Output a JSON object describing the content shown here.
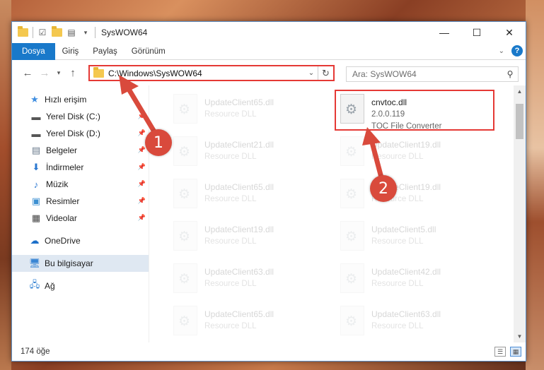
{
  "window": {
    "title": "SysWOW64",
    "controls": {
      "minimize": "—",
      "maximize": "☐",
      "close": "✕"
    }
  },
  "ribbon": {
    "tabs": [
      "Dosya",
      "Giriş",
      "Paylaş",
      "Görünüm"
    ],
    "active_tab": 0
  },
  "address_bar": {
    "path": "C:\\Windows\\SysWOW64",
    "search_placeholder": "Ara: SysWOW64"
  },
  "sidebar": {
    "quick_access": "Hızlı erişim",
    "items": [
      "Yerel Disk (C:)",
      "Yerel Disk (D:)",
      "Belgeler",
      "İndirmeler",
      "Müzik",
      "Resimler",
      "Videolar"
    ],
    "onedrive": "OneDrive",
    "this_pc": "Bu bilgisayar",
    "network": "Ağ"
  },
  "files_left": [
    {
      "name": "UpdateClient65.dll",
      "type": "Resource DLL"
    },
    {
      "name": "UpdateClient21.dll",
      "type": "Resource DLL"
    },
    {
      "name": "UpdateClient65.dll",
      "type": "Resource DLL"
    },
    {
      "name": "UpdateClient19.dll",
      "type": "Resource DLL"
    },
    {
      "name": "UpdateClient63.dll",
      "type": "Resource DLL"
    },
    {
      "name": "UpdateClient65.dll",
      "type": "Resource DLL"
    }
  ],
  "files_right": [
    {
      "name": "cnvtoc.dll",
      "version": "2.0.0.119",
      "type": "TOC File Converter"
    },
    {
      "name": "UpdateClient19.dll",
      "type": "Resource DLL"
    },
    {
      "name": "UpdateClient19.dll",
      "type": "Resource DLL"
    },
    {
      "name": "UpdateClient5.dll",
      "type": "Resource DLL"
    },
    {
      "name": "UpdateClient42.dll",
      "type": "Resource DLL"
    },
    {
      "name": "UpdateClient63.dll",
      "type": "Resource DLL"
    }
  ],
  "status": {
    "count": "174 öğe"
  },
  "callouts": [
    "1",
    "2"
  ],
  "colors": {
    "accent": "#1979ca",
    "highlight": "#e53935",
    "callout": "#d94a3c"
  },
  "icons": {
    "back": "arrow-left-icon",
    "forward": "arrow-right-icon",
    "recent": "chevron-down-icon",
    "up": "arrow-up-icon",
    "refresh": "refresh-icon",
    "search": "search-icon"
  }
}
